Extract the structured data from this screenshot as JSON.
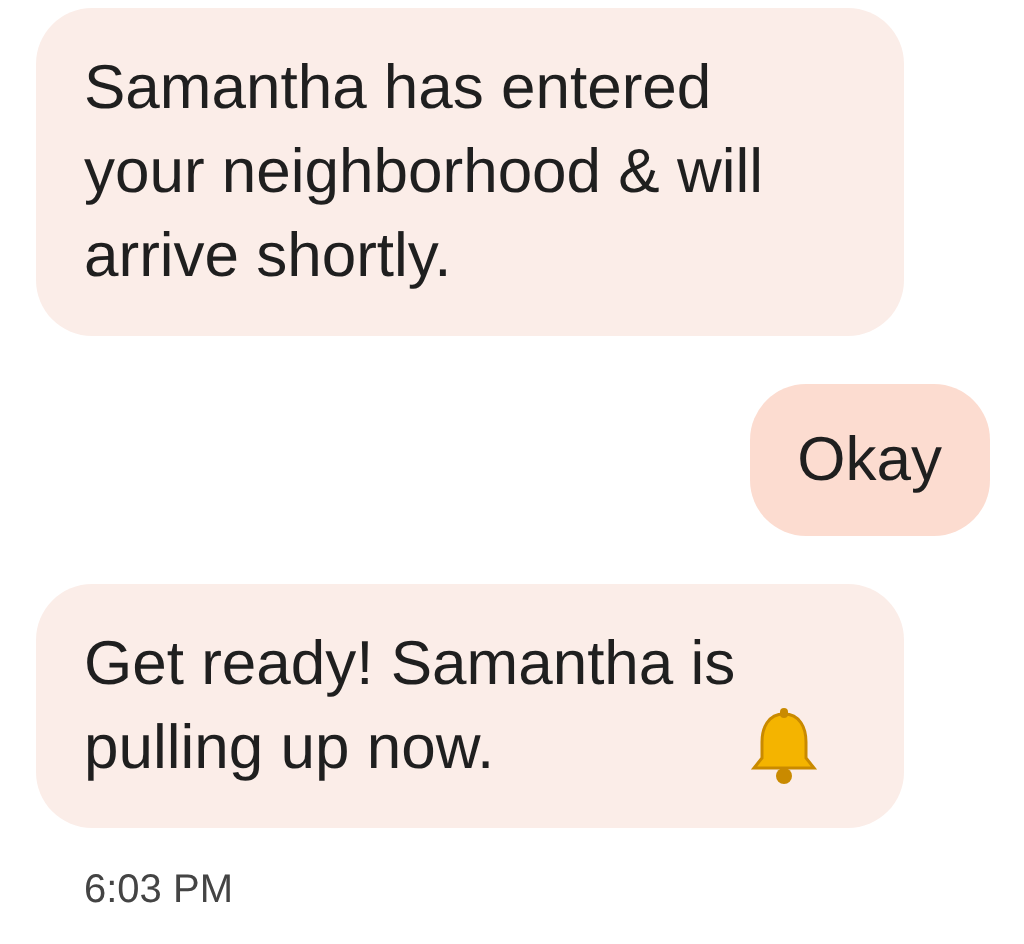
{
  "messages": [
    {
      "kind": "incoming",
      "text": "Samantha has entered your neighborhood & will arrive shortly.",
      "bell": false
    },
    {
      "kind": "outgoing",
      "text": "Okay",
      "bell": false
    },
    {
      "kind": "incoming",
      "text": "Get ready! Samantha is pulling up now.",
      "bell": true
    }
  ],
  "timestamp": "6:03 PM"
}
